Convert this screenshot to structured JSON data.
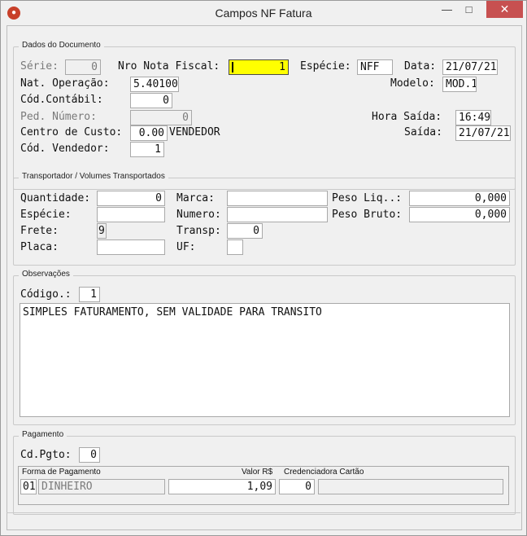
{
  "window": {
    "title": "Campos NF Fatura"
  },
  "dados": {
    "group_title": "Dados do Documento",
    "serie_label": "Série:",
    "serie_value": "0",
    "nro_label": "Nro Nota Fiscal:",
    "nro_value": "1",
    "especie_label": "Espécie:",
    "especie_value": "NFF",
    "data_label": "Data:",
    "data_value": "21/07/21",
    "nat_label": "Nat. Operação:",
    "nat_value": "5.40100",
    "modelo_label": "Modelo:",
    "modelo_value": "MOD.1",
    "cod_contabil_label": "Cód.Contábil:",
    "cod_contabil_value": "0",
    "ped_label": "Ped. Número:",
    "ped_value": "0",
    "hora_saida_label": "Hora Saída:",
    "hora_saida_value": "16:49",
    "centro_label": "Centro de Custo:",
    "centro_value": "0.00",
    "centro_desc": "VENDEDOR",
    "saida_label": "Saída:",
    "saida_value": "21/07/21",
    "cod_vend_label": "Cód. Vendedor:",
    "cod_vend_value": "1"
  },
  "transp": {
    "group_title": "Transportador / Volumes Transportados",
    "quantidade_label": "Quantidade:",
    "quantidade_value": "0",
    "marca_label": "Marca:",
    "marca_value": "",
    "peso_liq_label": "Peso Liq..:",
    "peso_liq_value": "0,000",
    "especie_label": "Espécie:",
    "especie_value": "",
    "numero_label": "Numero:",
    "numero_value": "",
    "peso_bruto_label": "Peso Bruto:",
    "peso_bruto_value": "0,000",
    "frete_label": "Frete:",
    "frete_value": "9",
    "transp_label": "Transp:",
    "transp_value": "0",
    "placa_label": "Placa:",
    "placa_value": "",
    "uf_label": "UF:",
    "uf_value": ""
  },
  "obs": {
    "group_title": "Observações",
    "codigo_label": "Código.:",
    "codigo_value": "1",
    "texto": "SIMPLES FATURAMENTO, SEM VALIDADE PARA TRANSITO"
  },
  "pagamento": {
    "group_title": "Pagamento",
    "cd_pgto_label": "Cd.Pgto:",
    "cd_pgto_value": "0",
    "col_forma": "Forma de Pagamento",
    "col_valor": "Valor R$",
    "col_cred": "Credenciadora Cartão",
    "forma_code": "01",
    "forma_desc": "DINHEIRO",
    "valor": "1,09",
    "cred_code": "0",
    "cred_desc": ""
  }
}
